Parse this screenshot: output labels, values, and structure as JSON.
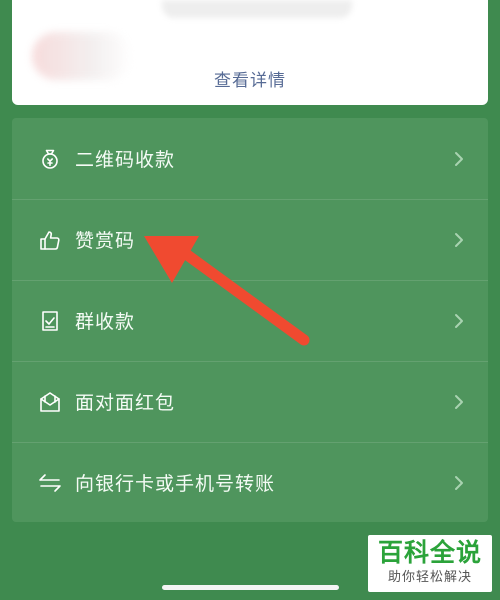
{
  "top_card": {
    "details_link": "查看详情"
  },
  "menu": {
    "items": [
      {
        "label": "二维码收款",
        "icon": "money-bag-icon"
      },
      {
        "label": "赞赏码",
        "icon": "thumbs-up-icon"
      },
      {
        "label": "群收款",
        "icon": "group-receipt-icon"
      },
      {
        "label": "面对面红包",
        "icon": "red-envelope-icon"
      },
      {
        "label": "向银行卡或手机号转账",
        "icon": "transfer-arrows-icon"
      }
    ]
  },
  "annotation": {
    "arrow_color": "#f04a30"
  },
  "watermark": {
    "title": "百科全说",
    "subtitle": "助你轻松解决"
  },
  "colors": {
    "background": "#3f8a4f",
    "menu_background": "#4f955d",
    "link": "#576b95",
    "watermark_green": "#2ba33a"
  }
}
